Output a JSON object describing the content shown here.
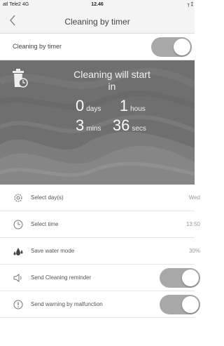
{
  "status_bar": {
    "carrier": "atl Tele2 4G",
    "time": "12.46",
    "right": "⁊ ⁑"
  },
  "nav": {
    "back_icon": "chevron-left-icon",
    "title": "Cleaning by timer"
  },
  "timer_toggle": {
    "label": "Cleaning by timer",
    "on": true
  },
  "hero": {
    "icon": "trash-timer-icon",
    "heading": "Cleaning will start in",
    "countdown": {
      "days": "0",
      "days_unit": "days",
      "hours": "1",
      "hours_unit": "hous",
      "mins": "3",
      "mins_unit": "mins",
      "secs": "36",
      "secs_unit": "secs"
    }
  },
  "settings": [
    {
      "icon": "gear-icon",
      "label": "Select day(s)",
      "value": "Wed"
    },
    {
      "icon": "clock-icon",
      "label": "Select time",
      "value": "13:50"
    },
    {
      "icon": "water-drops-icon",
      "label": "Save water mode",
      "value": "30%"
    },
    {
      "icon": "speaker-icon",
      "label": "Send Cleaning reminder",
      "toggle_on": true
    },
    {
      "icon": "warning-icon",
      "label": "Send warning by malfunction",
      "toggle_on": true
    }
  ],
  "colors": {
    "toggle_track": "#a8a8a8",
    "hero_background": "#6f6f6f",
    "header_background": "#f4f4f4"
  }
}
